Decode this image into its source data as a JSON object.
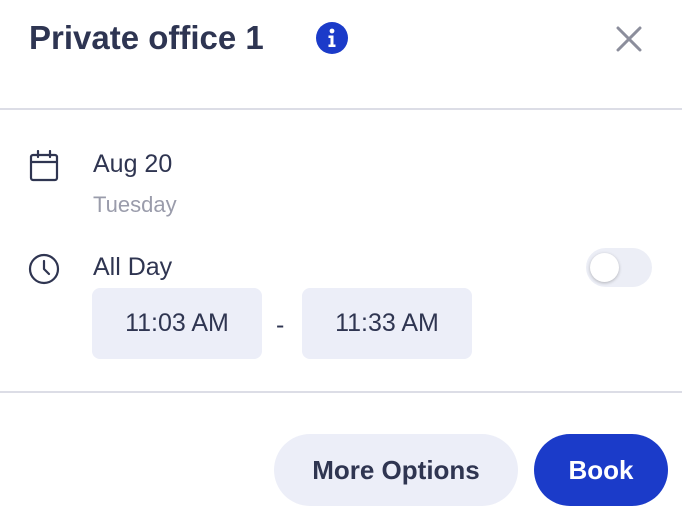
{
  "header": {
    "title": "Private office 1",
    "info_icon": "info-icon",
    "close_icon": "close-icon"
  },
  "date": {
    "icon": "calendar-icon",
    "date_label": "Aug 20",
    "weekday_label": "Tuesday"
  },
  "all_day": {
    "icon": "clock-icon",
    "label": "All Day",
    "toggle_on": false
  },
  "time": {
    "start": "11:03 AM",
    "separator": "-",
    "end": "11:33 AM"
  },
  "actions": {
    "more_options_label": "More Options",
    "book_label": "Book"
  },
  "colors": {
    "accent": "#1b3bc9",
    "text": "#2f3551",
    "muted": "#9a9cab",
    "field_bg": "#eceef8"
  }
}
